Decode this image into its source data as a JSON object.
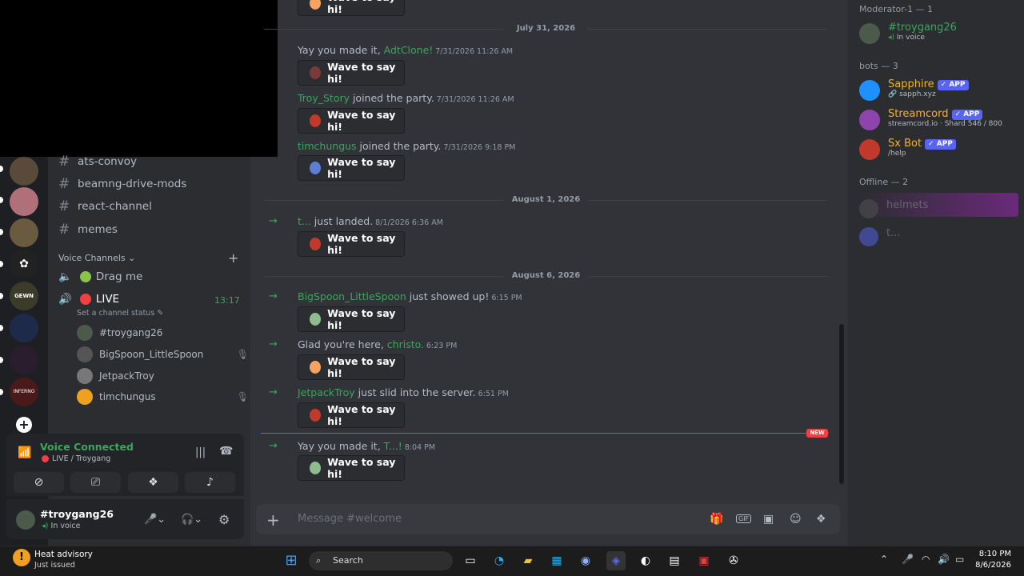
{
  "sidebar": {
    "text_channels": [
      "ats-convoy",
      "beamng-drive-mods",
      "react-channel",
      "memes"
    ],
    "voice_header": "Voice Channels",
    "voice_channels": [
      {
        "label": "Drag me"
      },
      {
        "label": "LIVE",
        "time": "13:17",
        "status": "Set a channel status"
      }
    ],
    "voice_users": [
      "#troygang26",
      "BigSpoon_LittleSpoon",
      "JetpackTroy",
      "timchungus"
    ]
  },
  "voice_panel": {
    "title": "Voice Connected",
    "sub": "LIVE / Troygang"
  },
  "user": {
    "name": "#troygang26",
    "status": "In voice"
  },
  "chat": {
    "dates": [
      "July 31, 2026",
      "August 1, 2026",
      "August 6, 2026"
    ],
    "wave_label": "Wave to say hi!",
    "messages": [
      {
        "pre": "Yay you made it, ",
        "name": "AdtClone!",
        "post": "",
        "ts": "7/31/2026 11:26 AM"
      },
      {
        "pre": "",
        "name": "Troy_Story",
        "post": " joined the party.",
        "ts": "7/31/2026 11:26 AM"
      },
      {
        "pre": "",
        "name": "timchungus",
        "post": " joined the party.",
        "ts": "7/31/2026 9:18 PM"
      },
      {
        "pre": "",
        "name": "t...",
        "post": " just landed.",
        "ts": "8/1/2026 6:36 AM"
      },
      {
        "pre": "",
        "name": "BigSpoon_LittleSpoon",
        "post": " just showed up!",
        "ts": "6:15 PM"
      },
      {
        "pre": "Glad you're here, ",
        "name": "christo.",
        "post": "",
        "ts": "6:23 PM"
      },
      {
        "pre": "",
        "name": "JetpackTroy",
        "post": " just slid into the server.",
        "ts": "6:51 PM"
      },
      {
        "pre": "Yay you made it, ",
        "name": "T...!",
        "post": "",
        "ts": "8:04 PM"
      }
    ],
    "new_badge": "NEW",
    "input_placeholder": "Message #welcome"
  },
  "members": {
    "sections": [
      "Moderator-1 — 1",
      "bots — 3",
      "Offline — 2"
    ],
    "list": [
      {
        "name": "#troygang26",
        "sub": "In voice",
        "color": "#3ba55c"
      },
      {
        "name": "Sapphire",
        "tag": "APP",
        "sub": "sapph.xyz",
        "color": "#f0b232"
      },
      {
        "name": "Streamcord",
        "tag": "APP",
        "sub": "streamcord.io · Shard 546 / 800",
        "color": "#f0b232"
      },
      {
        "name": "Sx Bot",
        "tag": "APP",
        "sub": "/help",
        "color": "#f0b232"
      },
      {
        "name": "helmets",
        "color": "#6d6f78"
      },
      {
        "name": "t...",
        "color": "#6d6f78"
      }
    ]
  },
  "taskbar": {
    "weather_title": "Heat advisory",
    "weather_sub": "Just issued",
    "search": "Search",
    "time": "8:10 PM",
    "date": "8/6/2026"
  }
}
